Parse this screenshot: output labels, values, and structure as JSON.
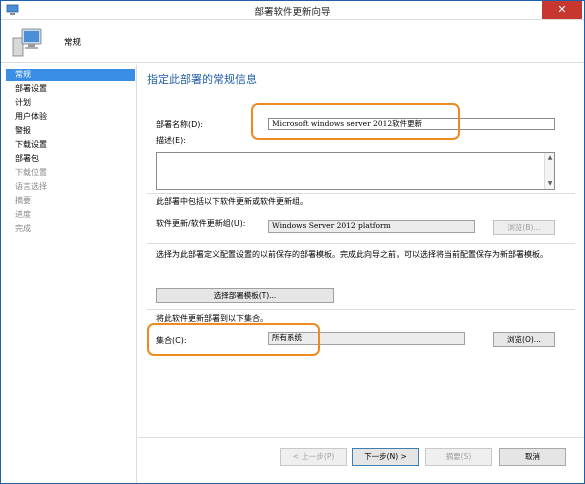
{
  "window": {
    "title": "部署软件更新向导",
    "close_glyph": "✕"
  },
  "header": {
    "title": "常规"
  },
  "nav": {
    "items": [
      {
        "label": "常规"
      },
      {
        "label": "部署设置"
      },
      {
        "label": "计划"
      },
      {
        "label": "用户体验"
      },
      {
        "label": "警报"
      },
      {
        "label": "下载设置"
      },
      {
        "label": "部署包"
      },
      {
        "label": "下载位置"
      },
      {
        "label": "语言选择"
      },
      {
        "label": "摘要"
      },
      {
        "label": "进度"
      },
      {
        "label": "完成"
      }
    ],
    "active_index": 0
  },
  "page": {
    "title": "指定此部署的常规信息",
    "deployment_name_label": "部署名称(D):",
    "deployment_name_value": "Microsoft windows server 2012软件更新",
    "description_label": "描述(E):",
    "description_value": "",
    "update_group_intro": "此部署中包括以下软件更新或软件更新组。",
    "update_group_label": "软件更新/软件更新组(U):",
    "update_group_value": "Windows Server 2012 platform",
    "browse_disabled_label": "浏览(B)...",
    "template_intro": "选择为此部署定义配置设置的以前保存的部署模板。完成此向导之前，可以选择将当前配置保存为新部署模板。",
    "select_template_label": "选择部署模板(T)...",
    "collection_intro": "将此软件更新部署到以下集合。",
    "collection_label": "集合(C):",
    "collection_value": "所有系统",
    "browse_collection_label": "浏览(O)..."
  },
  "footer": {
    "prev_label": "< 上一步(P)",
    "next_label": "下一步(N) >",
    "summary_label": "摘要(S)",
    "cancel_label": "取消"
  },
  "colors": {
    "accent": "#3a8ee6",
    "title_blue": "#1f5fa6",
    "highlight_orange": "#ef8a21",
    "close_red": "#c7372f"
  }
}
